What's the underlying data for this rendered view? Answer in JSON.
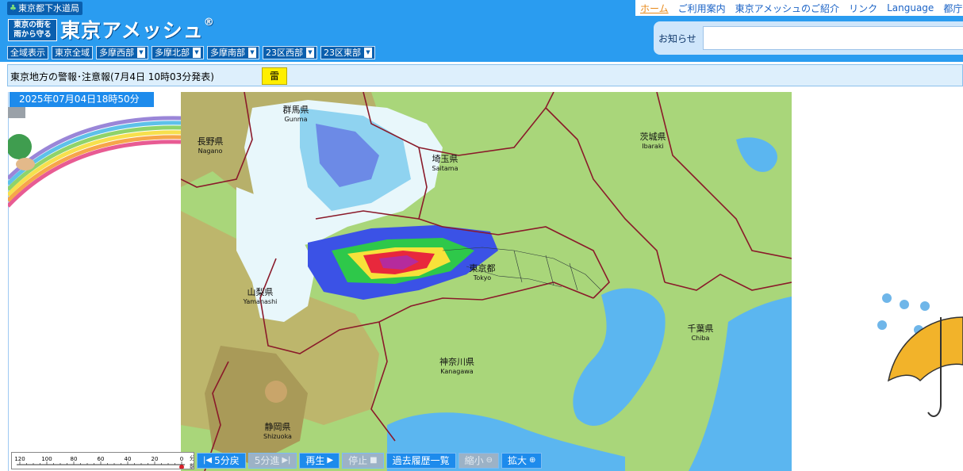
{
  "header": {
    "org_name": "東京都下水道局",
    "slogan_line1": "東京の街を",
    "slogan_line2": "雨から守る",
    "site_title": "東京アメッシュ",
    "registered": "®"
  },
  "nav": {
    "items": [
      {
        "label": "ホーム",
        "active": true
      },
      {
        "label": "ご利用案内"
      },
      {
        "label": "東京アメッシュのご紹介"
      },
      {
        "label": "リンク"
      },
      {
        "label": "Language"
      },
      {
        "label": "都庁"
      }
    ]
  },
  "notice": {
    "label": "お知らせ"
  },
  "areas": [
    {
      "label": "全域表示",
      "dropdown": false
    },
    {
      "label": "東京全域",
      "dropdown": false
    },
    {
      "label": "多摩西部",
      "dropdown": true
    },
    {
      "label": "多摩北部",
      "dropdown": true
    },
    {
      "label": "多摩南部",
      "dropdown": true
    },
    {
      "label": "23区西部",
      "dropdown": true
    },
    {
      "label": "23区東部",
      "dropdown": true
    }
  ],
  "warning": {
    "text": "東京地方の警報･注意報(7月4日 10時03分発表)",
    "tag": "雷"
  },
  "timestamp": "2025年07月04日18時50分",
  "map_labels": {
    "gunma": "群馬県",
    "gunma_en": "Gunma",
    "nagano": "長野県",
    "nagano_en": "Nagano",
    "saitama": "埼玉県",
    "saitama_en": "Saitama",
    "ibaraki": "茨城県",
    "ibaraki_en": "Ibaraki",
    "tokyo": "東京都",
    "tokyo_en": "Tokyo",
    "yamanashi": "山梨県",
    "yamanashi_en": "Yamanashi",
    "chiba": "千葉県",
    "chiba_en": "Chiba",
    "kanagawa": "神奈川県",
    "kanagawa_en": "Kanagawa",
    "shizuoka": "静岡県",
    "shizuoka_en": "Shizuoka"
  },
  "timeline": {
    "ticks": [
      "120",
      "100",
      "80",
      "60",
      "40",
      "20",
      "0"
    ],
    "unit_top": "分",
    "unit_bottom": "前"
  },
  "controls": [
    {
      "label": "5分戻",
      "glyph": "|◀",
      "enabled": true,
      "glyph_first": true
    },
    {
      "label": "5分進",
      "glyph": "▶|",
      "enabled": false,
      "glyph_first": false
    },
    {
      "label": "再生",
      "glyph": "▶",
      "enabled": true,
      "glyph_first": false
    },
    {
      "label": "停止",
      "glyph": "■",
      "enabled": false,
      "glyph_first": false
    },
    {
      "label": "過去履歴一覧",
      "glyph": "",
      "enabled": true,
      "glyph_first": false
    },
    {
      "label": "縮小",
      "glyph": "⊖",
      "enabled": false,
      "glyph_first": false
    },
    {
      "label": "拡大",
      "glyph": "⊕",
      "enabled": true,
      "glyph_first": false
    }
  ],
  "colors": {
    "header_bg": "#2a9cf0",
    "button_bg": "#0a5fae",
    "warning_tag": "#ffef00",
    "sea": "#5bb6f0",
    "land": "#a9d67a"
  }
}
